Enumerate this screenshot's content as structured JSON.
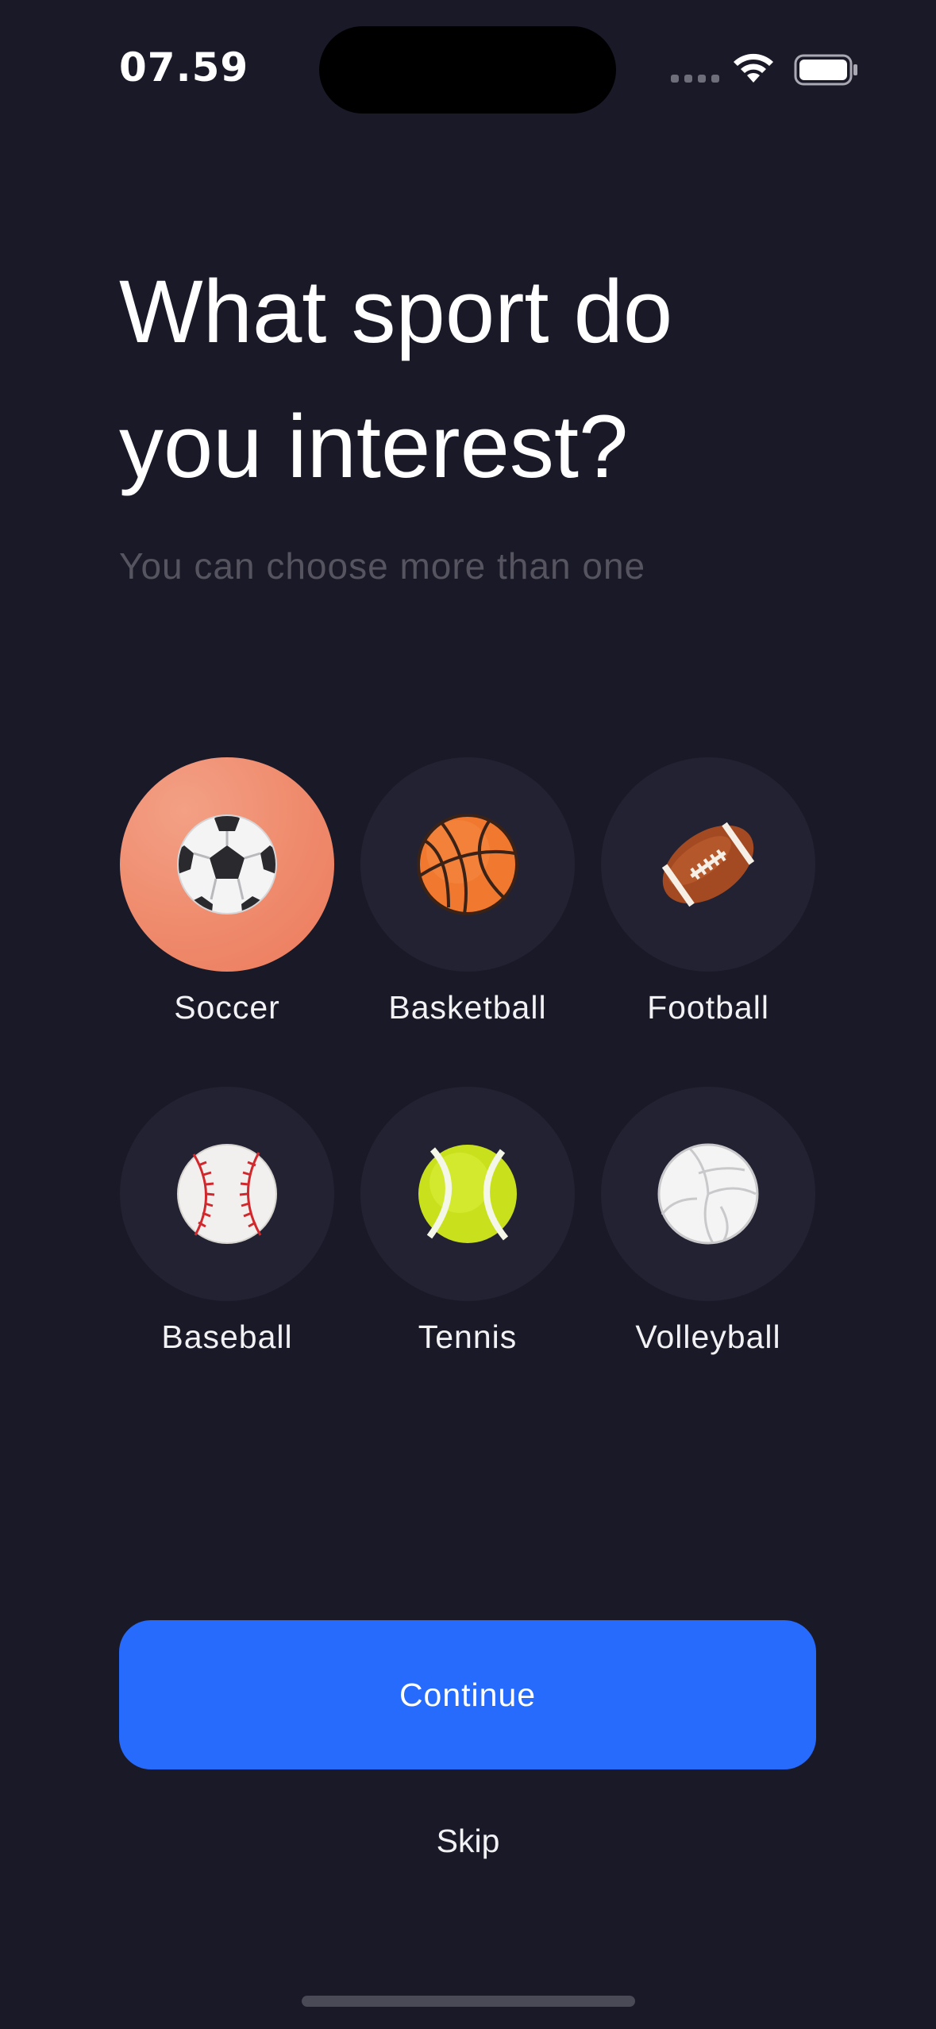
{
  "status_bar": {
    "time": "07.59"
  },
  "header": {
    "title_line1": "What sport do",
    "title_line2": "you interest?",
    "subtitle": "You can choose more than one"
  },
  "sports": [
    {
      "label": "Soccer",
      "icon": "soccer-ball-icon",
      "selected": true
    },
    {
      "label": "Basketball",
      "icon": "basketball-icon",
      "selected": false
    },
    {
      "label": "Football",
      "icon": "american-football-icon",
      "selected": false
    },
    {
      "label": "Baseball",
      "icon": "baseball-icon",
      "selected": false
    },
    {
      "label": "Tennis",
      "icon": "tennis-ball-icon",
      "selected": false
    },
    {
      "label": "Volleyball",
      "icon": "volleyball-icon",
      "selected": false
    }
  ],
  "actions": {
    "continue_label": "Continue",
    "skip_label": "Skip"
  },
  "colors": {
    "background": "#1a1928",
    "accent": "#276bfd",
    "selected": "#ef8a6c",
    "tile": "#232232"
  }
}
